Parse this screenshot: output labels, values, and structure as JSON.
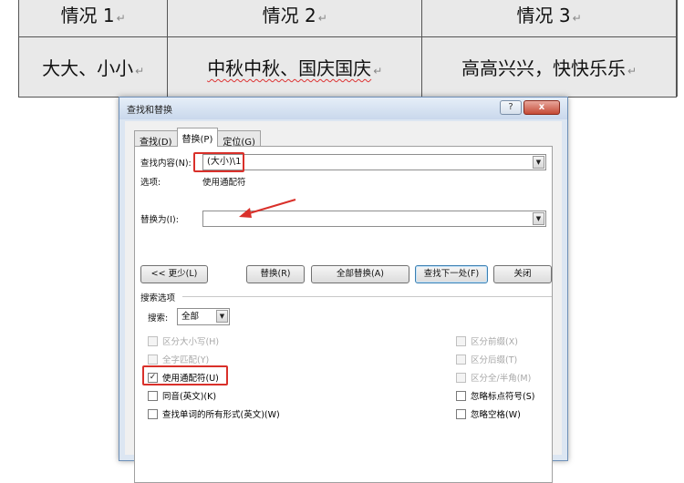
{
  "document_table": {
    "headers": [
      "情况 1",
      "情况 2",
      "情况 3"
    ],
    "row": [
      "大大、小小",
      "中秋中秋、国庆国庆",
      "高高兴兴，快快乐乐"
    ],
    "para_mark": "↵"
  },
  "dialog": {
    "title": "查找和替换",
    "help_btn": "?",
    "close_btn": "x",
    "tabs": [
      "查找(D)",
      "替换(P)",
      "定位(G)"
    ],
    "find_label": "查找内容(N):",
    "find_value": "(大小)\\1",
    "options_label": "选项:",
    "options_value": "使用通配符",
    "replace_label": "替换为(I):",
    "replace_value": "",
    "buttons": {
      "less": "<< 更少(L)",
      "replace": "替换(R)",
      "replace_all": "全部替换(A)",
      "find_next": "查找下一处(F)",
      "close": "关闭"
    },
    "search_options_title": "搜索选项",
    "search_label": "搜索:",
    "search_value": "全部",
    "left_options": [
      {
        "label": "区分大小写(H)",
        "checked": false,
        "disabled": true
      },
      {
        "label": "全字匹配(Y)",
        "checked": false,
        "disabled": true
      },
      {
        "label": "使用通配符(U)",
        "checked": true,
        "disabled": false
      },
      {
        "label": "同音(英文)(K)",
        "checked": false,
        "disabled": false
      },
      {
        "label": "查找单词的所有形式(英文)(W)",
        "checked": false,
        "disabled": false
      }
    ],
    "right_options": [
      {
        "label": "区分前缀(X)",
        "checked": false,
        "disabled": true
      },
      {
        "label": "区分后缀(T)",
        "checked": false,
        "disabled": true
      },
      {
        "label": "区分全/半角(M)",
        "checked": false,
        "disabled": true
      },
      {
        "label": "忽略标点符号(S)",
        "checked": false,
        "disabled": false
      },
      {
        "label": "忽略空格(W)",
        "checked": false,
        "disabled": false
      }
    ],
    "highlight_color": "#d9302a"
  }
}
